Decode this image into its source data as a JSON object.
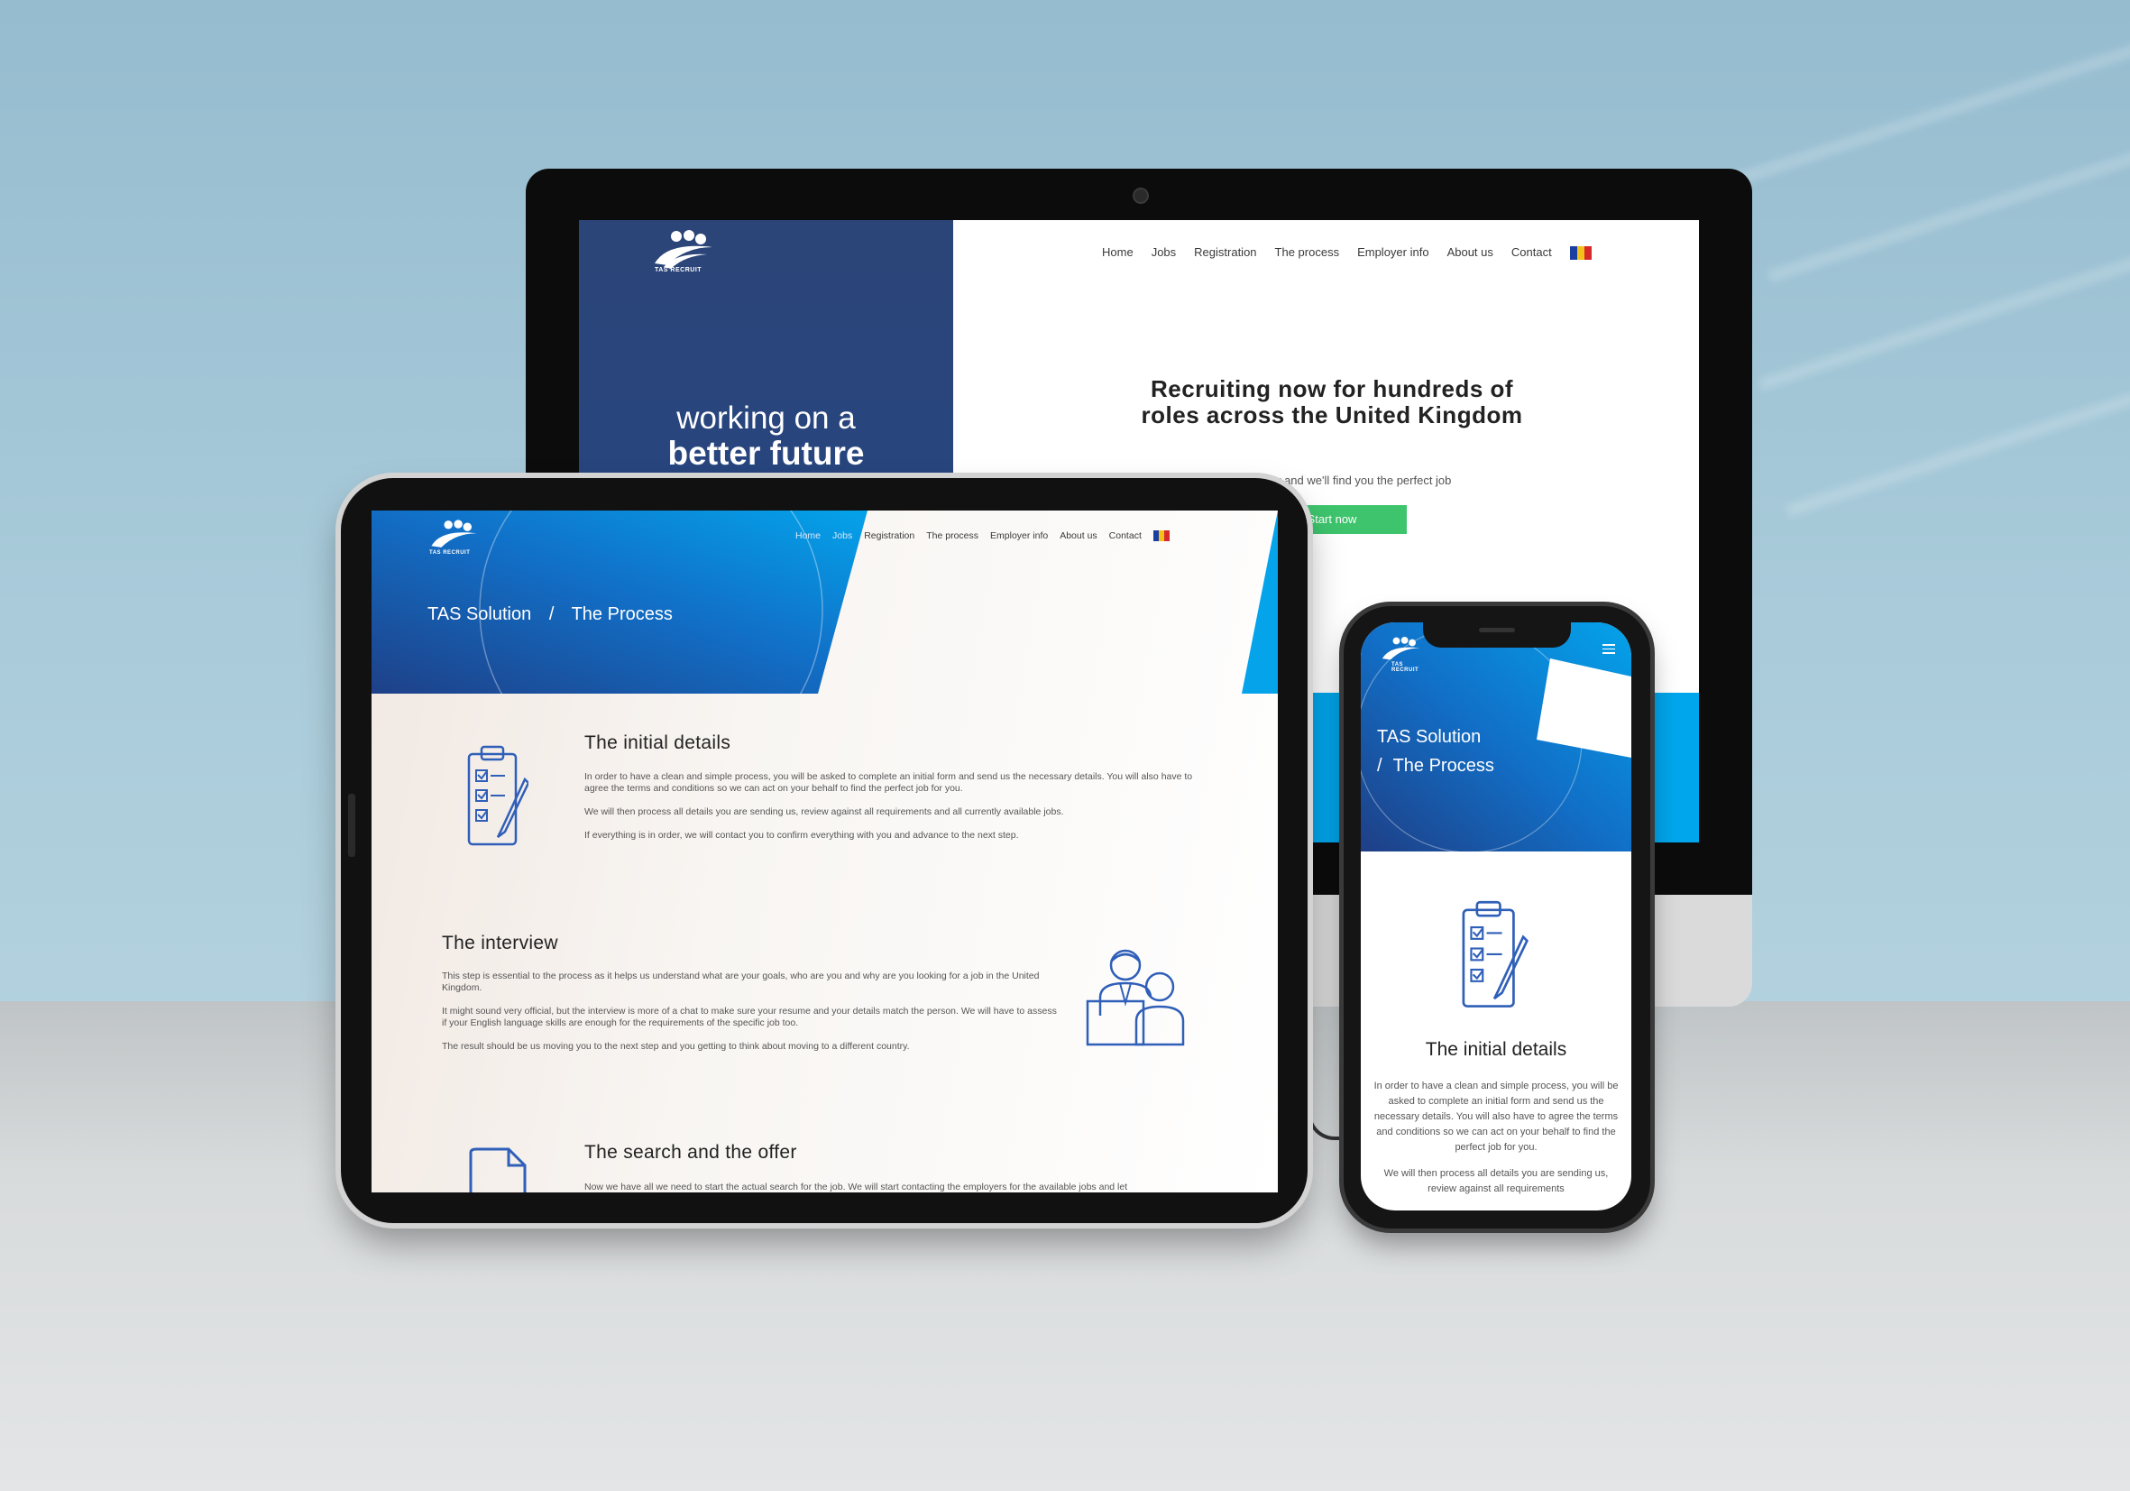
{
  "brand": {
    "logo_text": "TAS RECRUIT"
  },
  "nav": {
    "items": [
      "Home",
      "Jobs",
      "Registration",
      "The process",
      "Employer info",
      "About us",
      "Contact"
    ],
    "flag": "Romanian flag"
  },
  "desktop": {
    "hero_line1": "working on a",
    "hero_line2": "better future",
    "headline": "Recruiting now for hundreds of roles across the United Kingdom",
    "subtext": "Register now and we'll find you the perfect job",
    "cta": "Start now"
  },
  "tablet": {
    "breadcrumb_root": "TAS Solution",
    "breadcrumb_sep": "/",
    "breadcrumb_current": "The Process",
    "sections": [
      {
        "title": "The initial details",
        "paragraphs": [
          "In order to have a clean and simple process, you will be asked to complete an initial form and send us the necessary details. You will also have to agree the terms and conditions so we can act on your behalf to find the perfect job for you.",
          "We will then process all details you are sending us, review against all requirements and all currently available jobs.",
          "If everything is in order, we will contact you to confirm everything with you and advance to the next step."
        ],
        "icon": "clipboard-checklist-icon"
      },
      {
        "title": "The interview",
        "paragraphs": [
          "This step is essential to the process as it helps us understand what are your goals, who are you and why are you looking for a job in the United Kingdom.",
          "It might sound very official, but the interview is more of a chat to make sure your resume and your details match the person. We will have to assess if your English language skills are enough for the requirements of the specific job too.",
          "The result should be us moving you to the next step and you getting to think about moving to a different country."
        ],
        "icon": "interview-people-icon"
      },
      {
        "title": "The search and the offer",
        "paragraphs": [
          "Now we have all we need to start the actual search for the job. We will start contacting the employers for the available jobs and let"
        ],
        "icon": "document-folder-icon"
      }
    ]
  },
  "phone": {
    "breadcrumb_root": "TAS Solution",
    "breadcrumb_sep": "/",
    "breadcrumb_current": "The Process",
    "menu_icon": "hamburger-icon",
    "section_title": "The initial details",
    "paragraph1": "In order to have a clean and simple process, you will be asked to complete an initial form and send us the necessary details. You will also have to agree the terms and conditions so we can act on your behalf to find the perfect job for you.",
    "paragraph2": "We will then process all details you are sending us, review against all requirements"
  },
  "colors": {
    "navy": "#2c4578",
    "cyan": "#00a6ec",
    "green": "#3ec46d",
    "icon_blue": "#2f5fb8"
  }
}
